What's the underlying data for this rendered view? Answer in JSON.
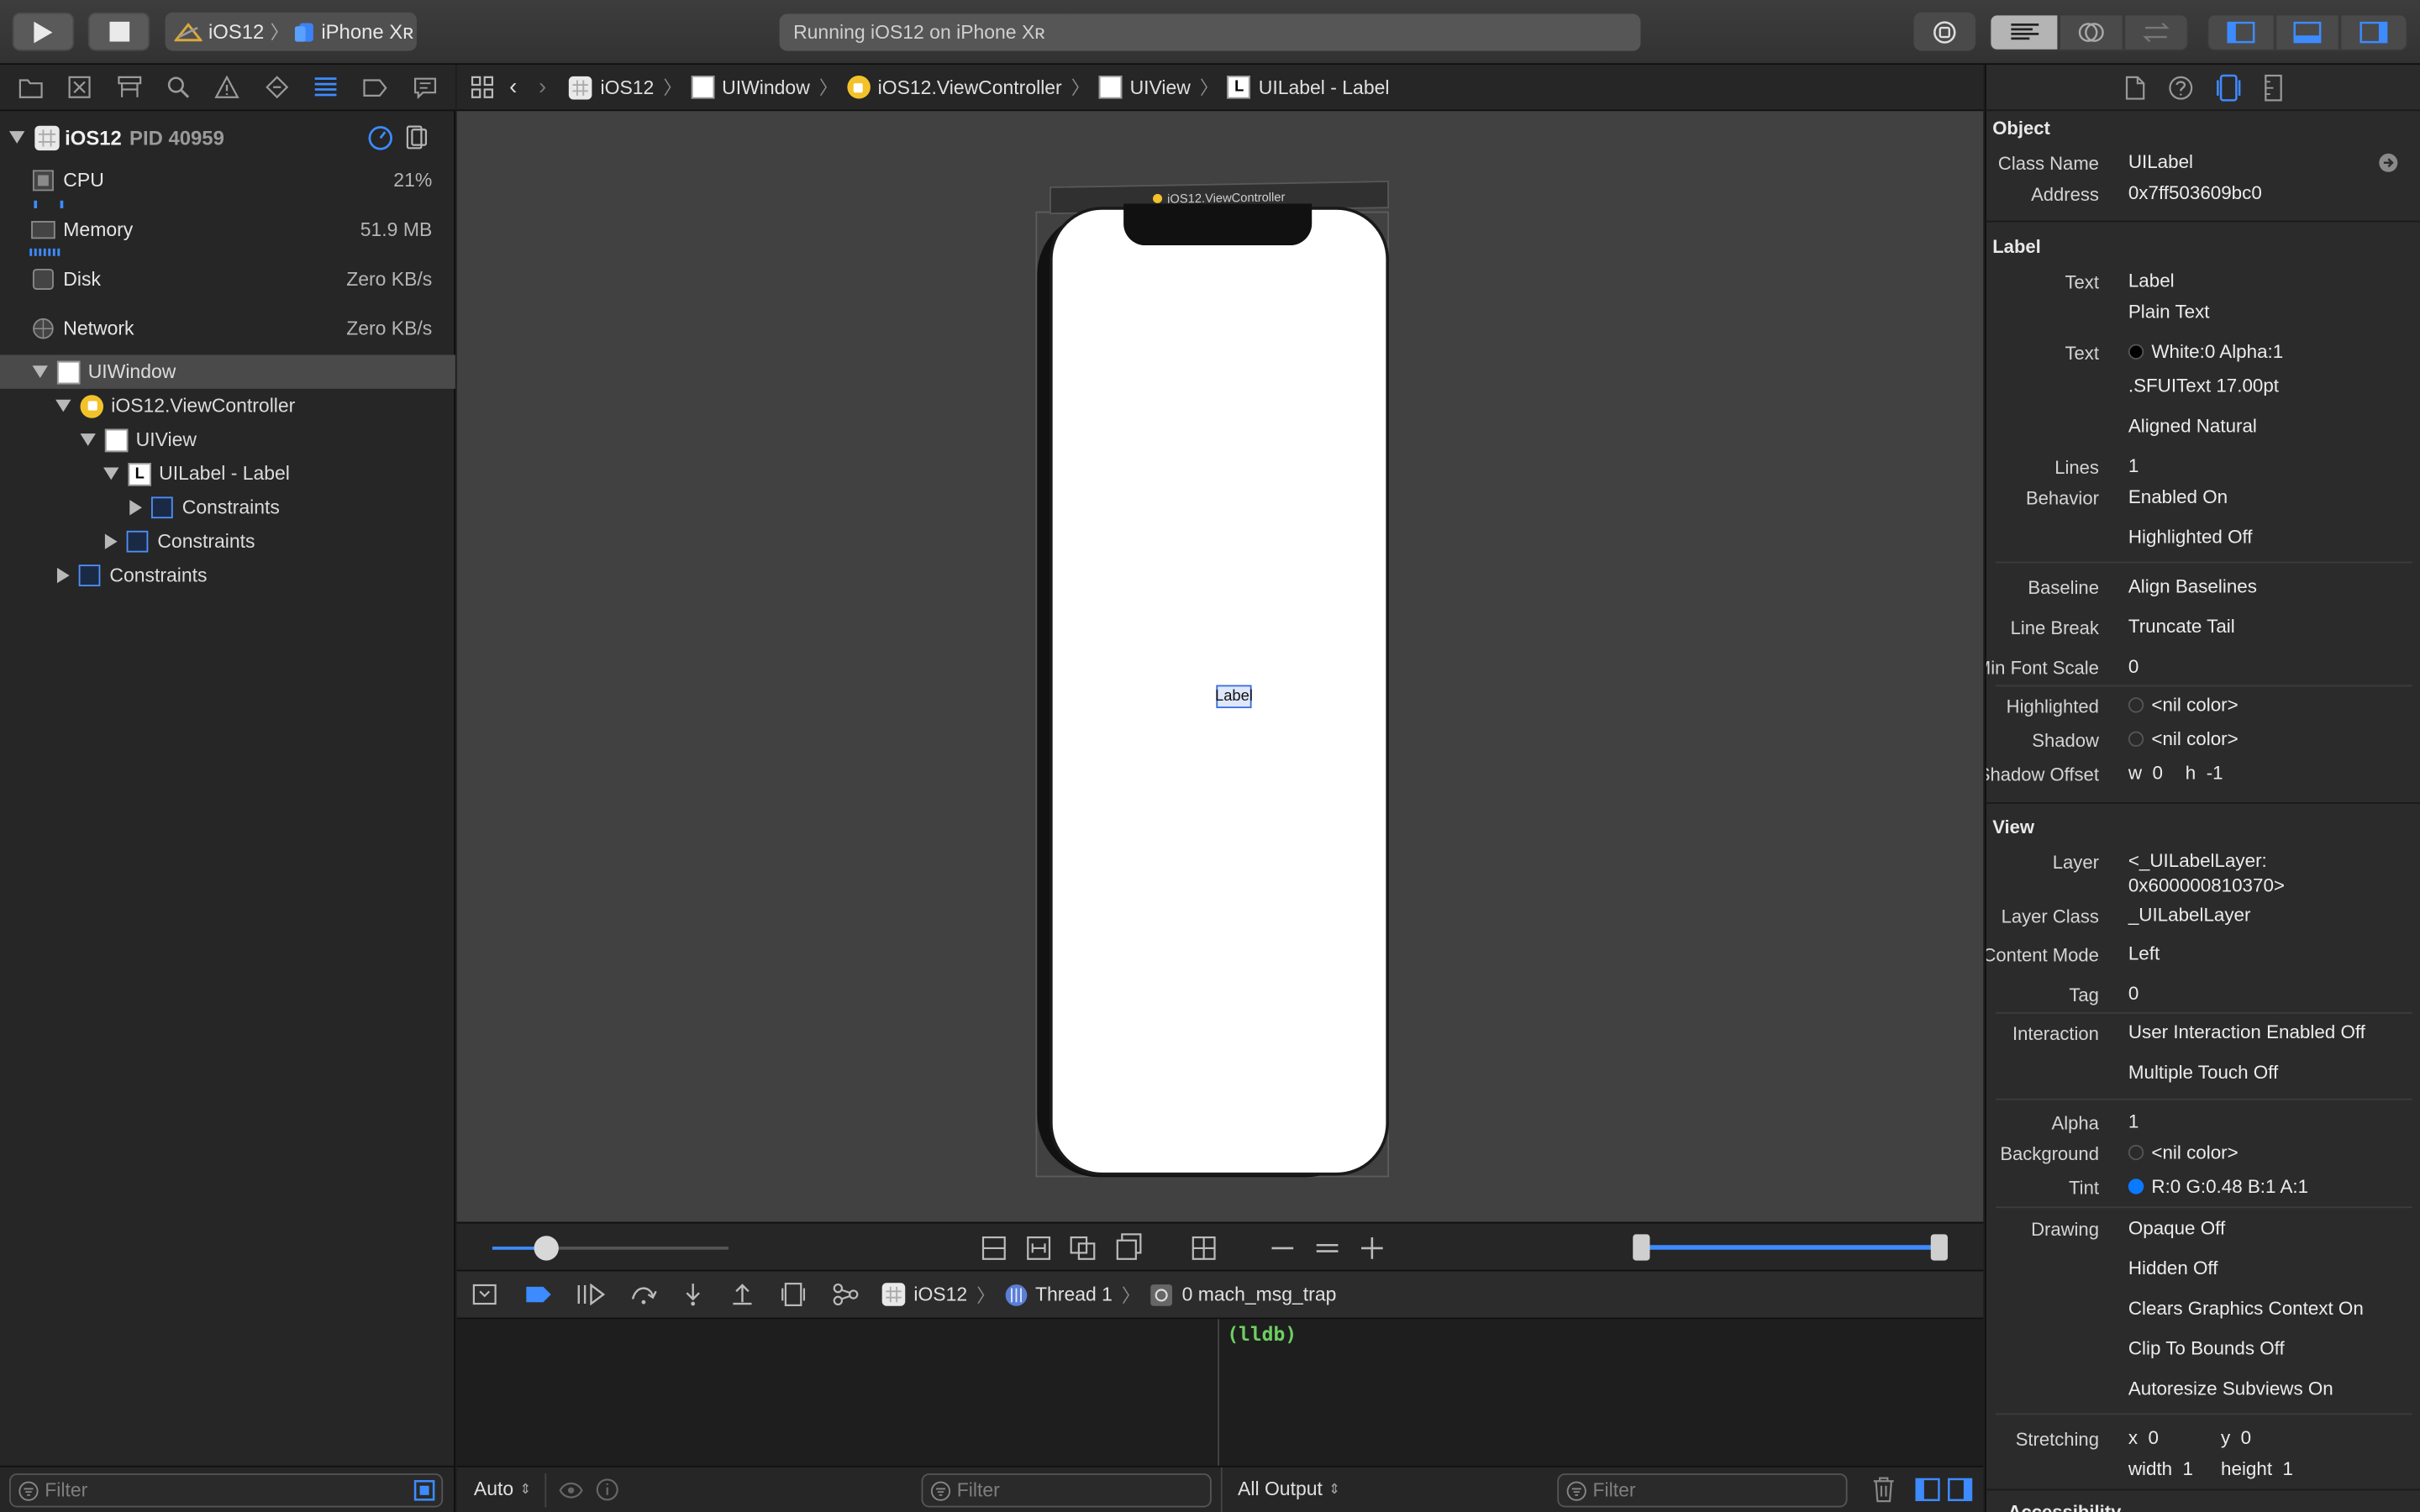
{
  "toolbar": {
    "scheme": "iOS12",
    "device": "iPhone Xʀ",
    "activity": "Running iOS12 on iPhone Xʀ"
  },
  "process": {
    "name": "iOS12",
    "pid": "PID 40959"
  },
  "gauges": [
    {
      "label": "CPU",
      "value": "21%"
    },
    {
      "label": "Memory",
      "value": "51.9 MB"
    },
    {
      "label": "Disk",
      "value": "Zero KB/s"
    },
    {
      "label": "Network",
      "value": "Zero KB/s"
    }
  ],
  "tree": [
    {
      "label": "UIWindow"
    },
    {
      "label": "iOS12.ViewController"
    },
    {
      "label": "UIView"
    },
    {
      "label": "UILabel - Label"
    },
    {
      "label": "Constraints"
    },
    {
      "label": "Constraints"
    },
    {
      "label": "Constraints"
    }
  ],
  "breadcrumb": [
    "iOS12",
    "UIWindow",
    "iOS12.ViewController",
    "UIView",
    "UILabel - Label"
  ],
  "canvas": {
    "vc_title": "iOS12.ViewController",
    "label_text": "Label"
  },
  "debug": {
    "crumbs": [
      "iOS12",
      "Thread 1",
      "0 mach_msg_trap"
    ],
    "console_prompt": "(lldb)",
    "auto_label": "Auto",
    "output_label": "All Output",
    "filter_placeholder": "Filter"
  },
  "inspector": {
    "object": {
      "title": "Object",
      "class_name_key": "Class Name",
      "class_name": "UILabel",
      "address_key": "Address",
      "address": "0x7ff503609bc0"
    },
    "label": {
      "title": "Label",
      "text_key": "Text",
      "text": "Label",
      "text_type": "Plain Text",
      "color_key": "Text",
      "color": "White:0 Alpha:1",
      "font": ".SFUIText 17.00pt",
      "alignment": "Aligned Natural",
      "lines_key": "Lines",
      "lines": "1",
      "behavior_key": "Behavior",
      "enabled": "Enabled On",
      "highlighted": "Highlighted Off",
      "baseline_key": "Baseline",
      "baseline": "Align Baselines",
      "linebreak_key": "Line Break",
      "linebreak": "Truncate Tail",
      "minfont_key": "Min Font Scale",
      "minfont": "0",
      "highlighted_key": "Highlighted",
      "highlighted_color": "<nil color>",
      "shadow_key": "Shadow",
      "shadow_color": "<nil color>",
      "shadow_offset_key": "Shadow Offset",
      "shadow_w": "w  0",
      "shadow_h": "h  -1"
    },
    "view": {
      "title": "View",
      "layer_key": "Layer",
      "layer": "<_UILabelLayer:",
      "layer2": "0x600000810370>",
      "layer_class_key": "Layer Class",
      "layer_class": "_UILabelLayer",
      "content_mode_key": "Content Mode",
      "content_mode": "Left",
      "tag_key": "Tag",
      "tag": "0",
      "interaction_key": "Interaction",
      "interaction1": "User Interaction Enabled Off",
      "interaction2": "Multiple Touch Off",
      "alpha_key": "Alpha",
      "alpha": "1",
      "background_key": "Background",
      "background": "<nil color>",
      "tint_key": "Tint",
      "tint": "R:0 G:0.48 B:1 A:1",
      "drawing_key": "Drawing",
      "drawing1": "Opaque Off",
      "drawing2": "Hidden Off",
      "drawing3": "Clears Graphics Context On",
      "drawing4": "Clip To Bounds Off",
      "drawing5": "Autoresize Subviews On",
      "stretching_key": "Stretching",
      "stretch_x": "x  0",
      "stretch_y": "y  0",
      "stretch_w": "width  1",
      "stretch_h": "height  1"
    },
    "next_section": "Accessibility"
  },
  "colors": {
    "accent": "#2f7ef6",
    "text_color_swatch": "#000000",
    "tint_swatch": "#0a7aff",
    "console_green": "#6dcf60"
  }
}
